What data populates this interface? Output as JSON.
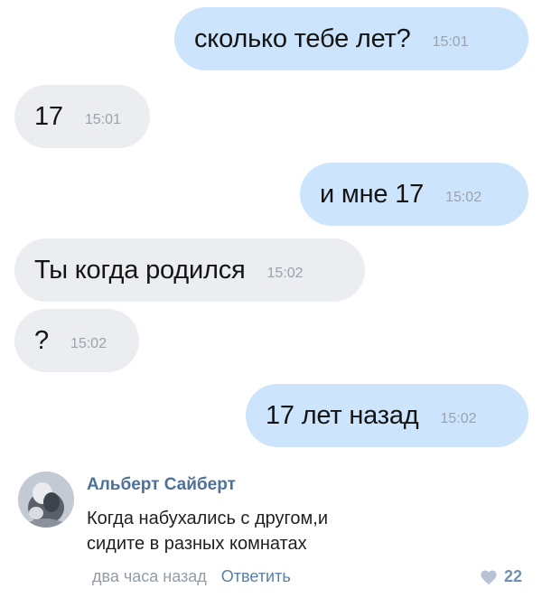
{
  "messages": [
    {
      "direction": "outgoing",
      "text": "сколько тебе лет?",
      "time": "15:01"
    },
    {
      "direction": "incoming",
      "text": "17",
      "time": "15:01"
    },
    {
      "direction": "outgoing",
      "text": "и мне 17",
      "time": "15:02"
    },
    {
      "direction": "incoming",
      "text": "Ты когда родился",
      "time": "15:02"
    },
    {
      "direction": "incoming",
      "text": "?",
      "time": "15:02"
    },
    {
      "direction": "outgoing",
      "text": "17 лет назад",
      "time": "15:02"
    }
  ],
  "comment": {
    "author": "Альберт Сайберт",
    "text_lines": [
      "Когда набухались с другом,и",
      "сидите в разных комнатах"
    ],
    "posted": "два часа назад",
    "reply_label": "Ответить",
    "likes": "22",
    "like_icon": "heart-icon"
  },
  "colors": {
    "outgoing_bubble": "#cce4fc",
    "incoming_bubble": "#ebedf0",
    "author_link": "#4d7198",
    "reply_link": "#5a7ea6",
    "muted_text": "#939ca6"
  }
}
